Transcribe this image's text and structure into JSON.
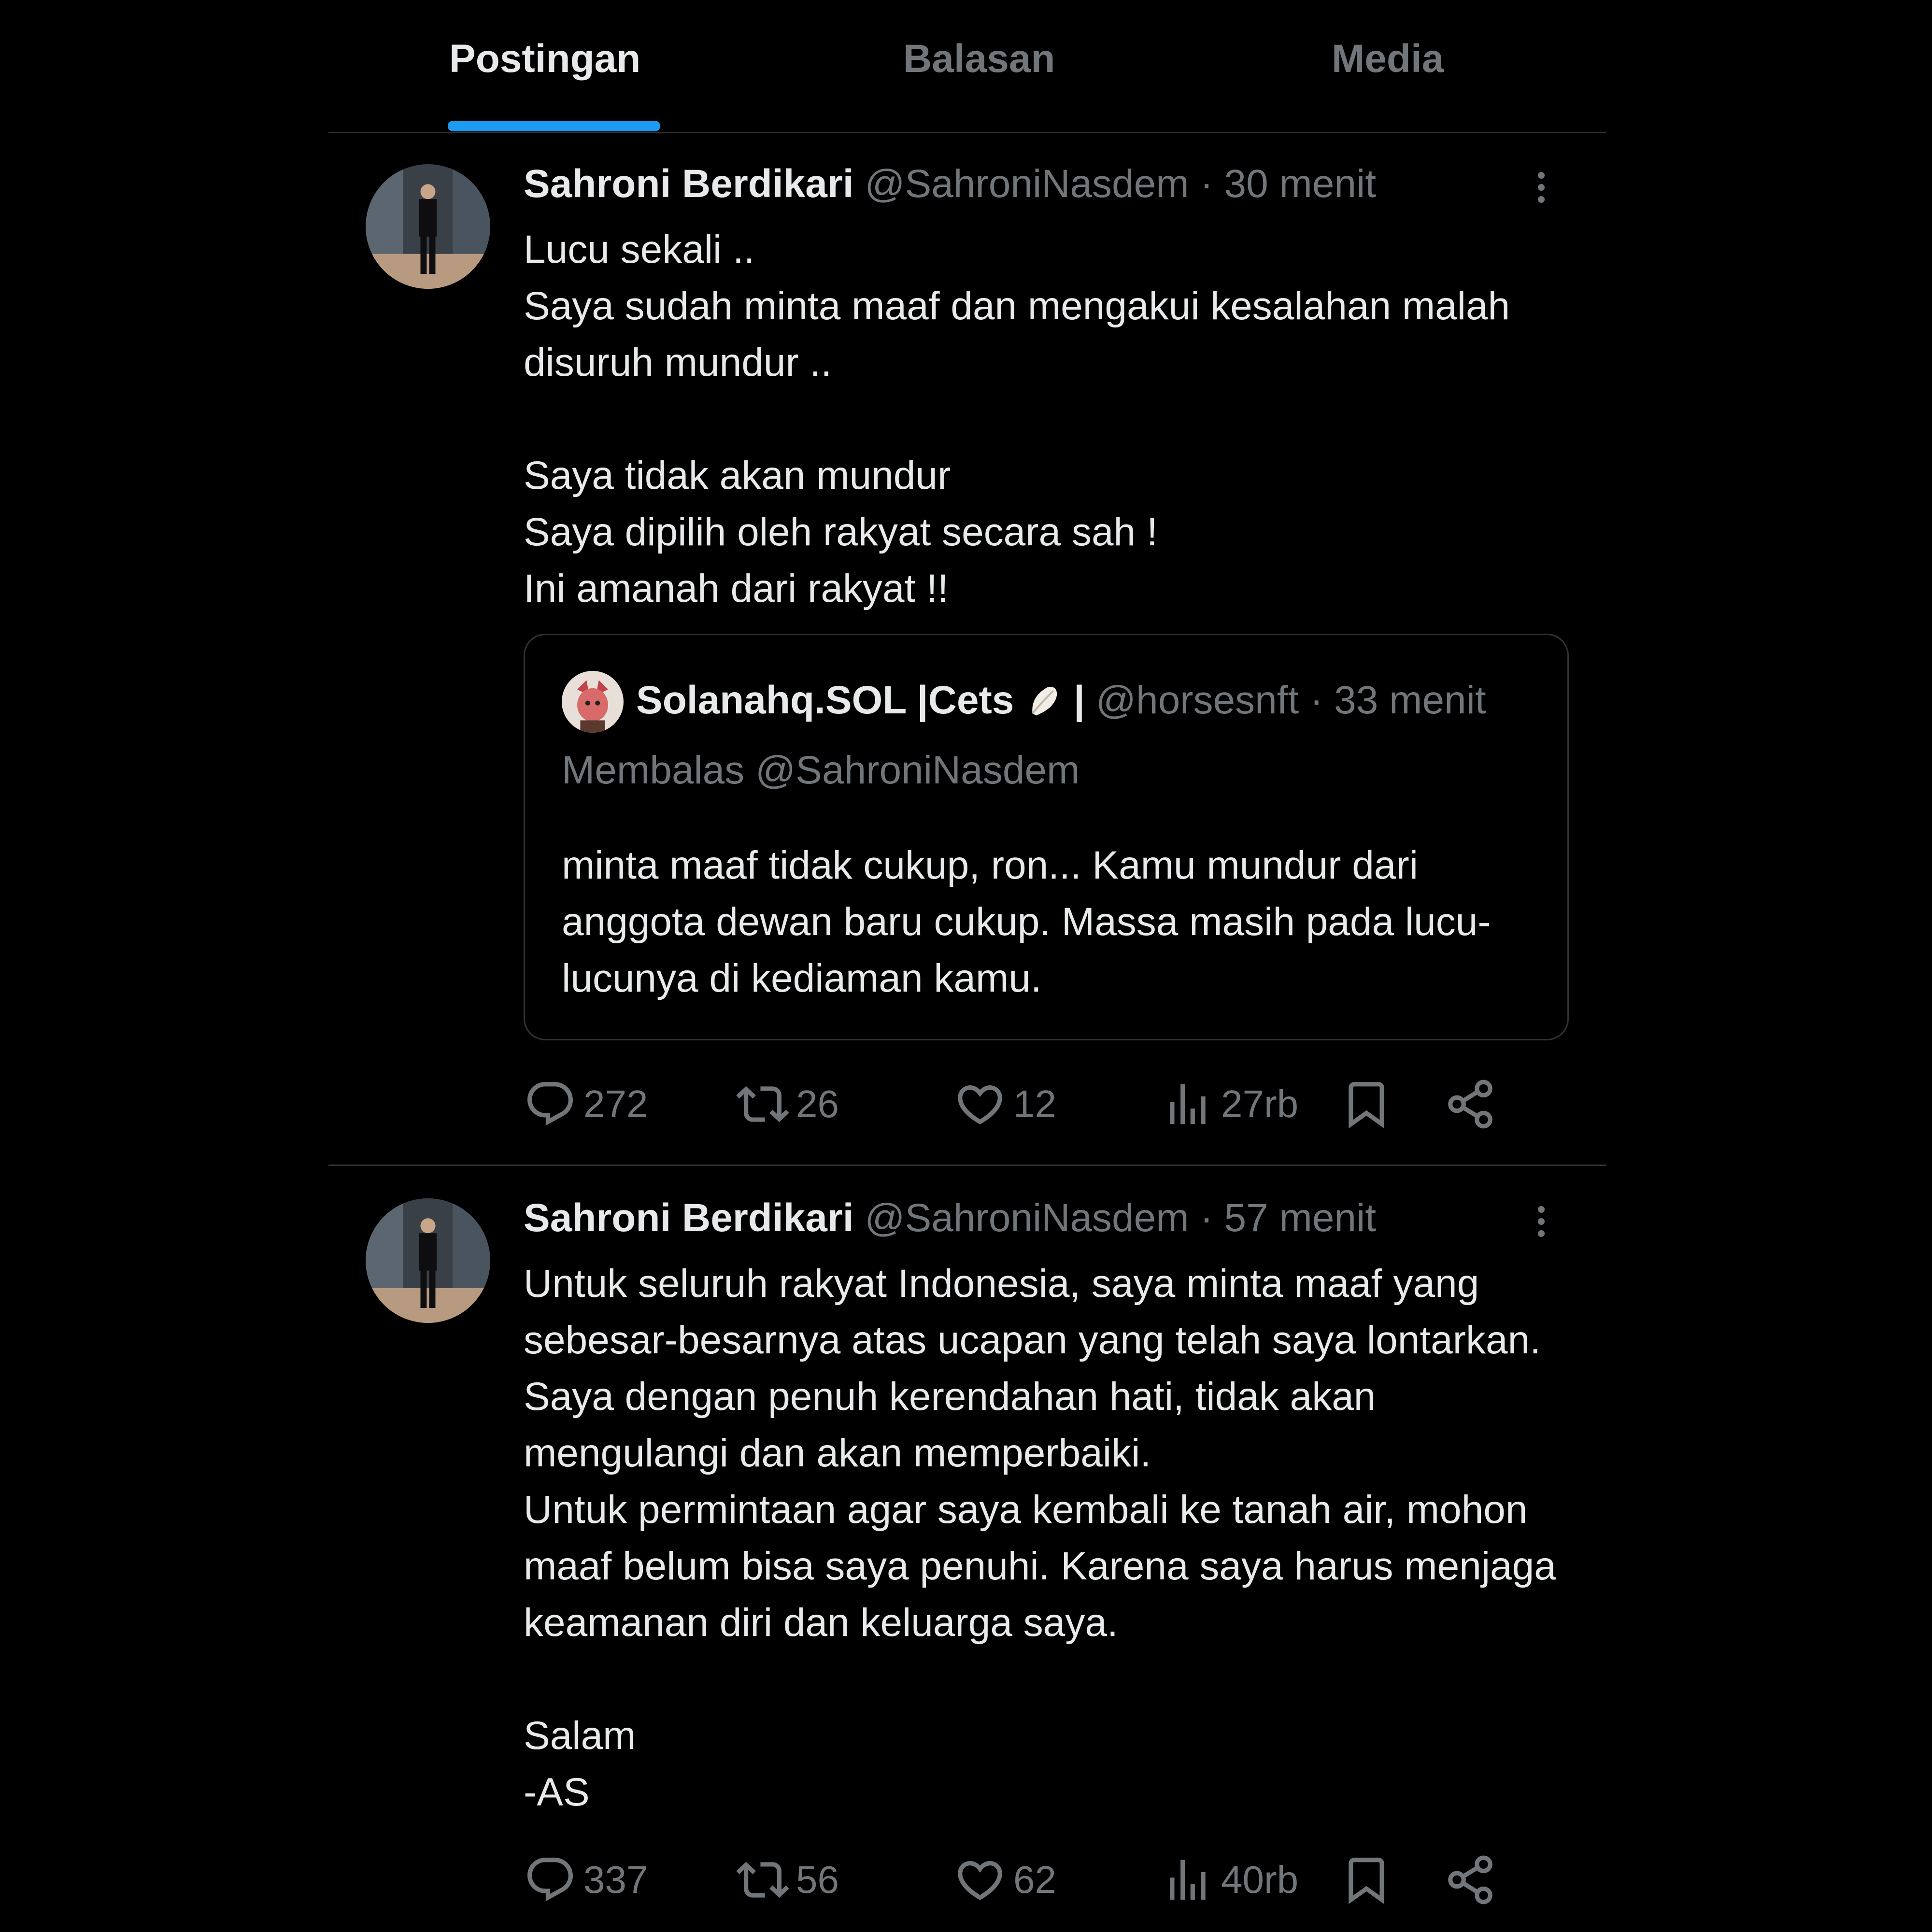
{
  "tabs": [
    {
      "label": "Postingan",
      "active": true
    },
    {
      "label": "Balasan",
      "active": false
    },
    {
      "label": "Media",
      "active": false
    }
  ],
  "colors": {
    "accent": "#1d9bf0",
    "muted": "#71767b",
    "text": "#e7e9ea",
    "border": "#2f3336"
  },
  "posts": [
    {
      "name": "Sahroni Berdikari",
      "handle": "@SahroniNasdem",
      "dot": "·",
      "time": "30 menit",
      "text": "Lucu sekali ..\nSaya sudah minta maaf dan mengakui kesalahan malah disuruh mundur ..\n\nSaya tidak akan mundur\nSaya dipilih oleh rakyat secara sah !\nIni amanah dari rakyat !!",
      "quote": {
        "name": "Solanahq.SOL |Cets",
        "name_suffix": "|",
        "handle": "@horsesnft",
        "dot": "·",
        "time": "33 menit",
        "reply_to": "Membalas @SahroniNasdem",
        "text": "minta maaf tidak cukup, ron... Kamu mundur dari anggota dewan baru cukup. Massa masih pada lucu-lucunya di kediaman kamu."
      },
      "stats": {
        "replies": "272",
        "reposts": "26",
        "likes": "12",
        "views": "27rb"
      }
    },
    {
      "name": "Sahroni Berdikari",
      "handle": "@SahroniNasdem",
      "dot": "·",
      "time": "57 menit",
      "text": "Untuk seluruh rakyat Indonesia, saya minta maaf yang sebesar-besarnya atas ucapan yang telah saya lontarkan. Saya dengan penuh kerendahan hati, tidak akan mengulangi dan akan memperbaiki.\nUntuk permintaan agar saya kembali ke tanah air, mohon maaf belum bisa saya penuhi. Karena saya harus menjaga keamanan diri dan keluarga saya.\n\nSalam\n-AS",
      "stats": {
        "replies": "337",
        "reposts": "56",
        "likes": "62",
        "views": "40rb"
      }
    }
  ]
}
